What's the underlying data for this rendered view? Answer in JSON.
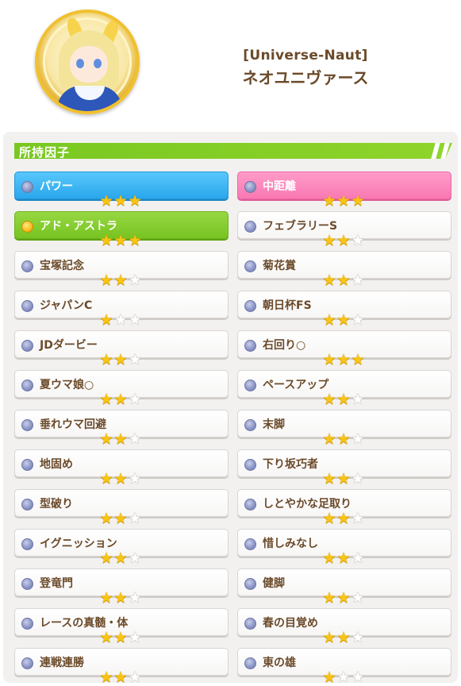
{
  "profile": {
    "subtitle": "[Universe-Naut]",
    "name": "ネオユニヴァース"
  },
  "section": {
    "title": "所持因子"
  },
  "factors": [
    {
      "label": "パワー",
      "stars": 3,
      "style": "blue",
      "dot": "silver"
    },
    {
      "label": "中距離",
      "stars": 3,
      "style": "pink",
      "dot": "silver"
    },
    {
      "label": "アド・アストラ",
      "stars": 3,
      "style": "green",
      "dot": "gold"
    },
    {
      "label": "フェブラリーS",
      "stars": 2,
      "style": "white",
      "dot": "silver"
    },
    {
      "label": "宝塚記念",
      "stars": 2,
      "style": "white",
      "dot": "silver"
    },
    {
      "label": "菊花賞",
      "stars": 2,
      "style": "white",
      "dot": "silver"
    },
    {
      "label": "ジャパンC",
      "stars": 1,
      "style": "white",
      "dot": "silver"
    },
    {
      "label": "朝日杯FS",
      "stars": 2,
      "style": "white",
      "dot": "silver"
    },
    {
      "label": "JDダービー",
      "stars": 2,
      "style": "white",
      "dot": "silver"
    },
    {
      "label": "右回り○",
      "stars": 3,
      "style": "white",
      "dot": "silver"
    },
    {
      "label": "夏ウマ娘○",
      "stars": 2,
      "style": "white",
      "dot": "silver"
    },
    {
      "label": "ペースアップ",
      "stars": 2,
      "style": "white",
      "dot": "silver"
    },
    {
      "label": "垂れウマ回避",
      "stars": 2,
      "style": "white",
      "dot": "silver"
    },
    {
      "label": "末脚",
      "stars": 2,
      "style": "white",
      "dot": "silver"
    },
    {
      "label": "地固め",
      "stars": 2,
      "style": "white",
      "dot": "silver"
    },
    {
      "label": "下り坂巧者",
      "stars": 2,
      "style": "white",
      "dot": "silver"
    },
    {
      "label": "型破り",
      "stars": 2,
      "style": "white",
      "dot": "silver"
    },
    {
      "label": "しとやかな足取り",
      "stars": 2,
      "style": "white",
      "dot": "silver"
    },
    {
      "label": "イグニッション",
      "stars": 2,
      "style": "white",
      "dot": "silver"
    },
    {
      "label": "惜しみなし",
      "stars": 2,
      "style": "white",
      "dot": "silver"
    },
    {
      "label": "登竜門",
      "stars": 2,
      "style": "white",
      "dot": "silver"
    },
    {
      "label": "健脚",
      "stars": 2,
      "style": "white",
      "dot": "silver"
    },
    {
      "label": "レースの真髄・体",
      "stars": 2,
      "style": "white",
      "dot": "silver"
    },
    {
      "label": "春の目覚め",
      "stars": 2,
      "style": "white",
      "dot": "silver"
    },
    {
      "label": "連戦連勝",
      "stars": 2,
      "style": "white",
      "dot": "silver"
    },
    {
      "label": "東の雄",
      "stars": 1,
      "style": "white",
      "dot": "silver"
    }
  ],
  "colors": {
    "text": "#6b4a2a",
    "section_bar": "#79c821",
    "blue_factor": "#2aa7ec",
    "pink_factor": "#f978b2",
    "green_factor": "#78c322",
    "star_on": "#f9c414"
  }
}
